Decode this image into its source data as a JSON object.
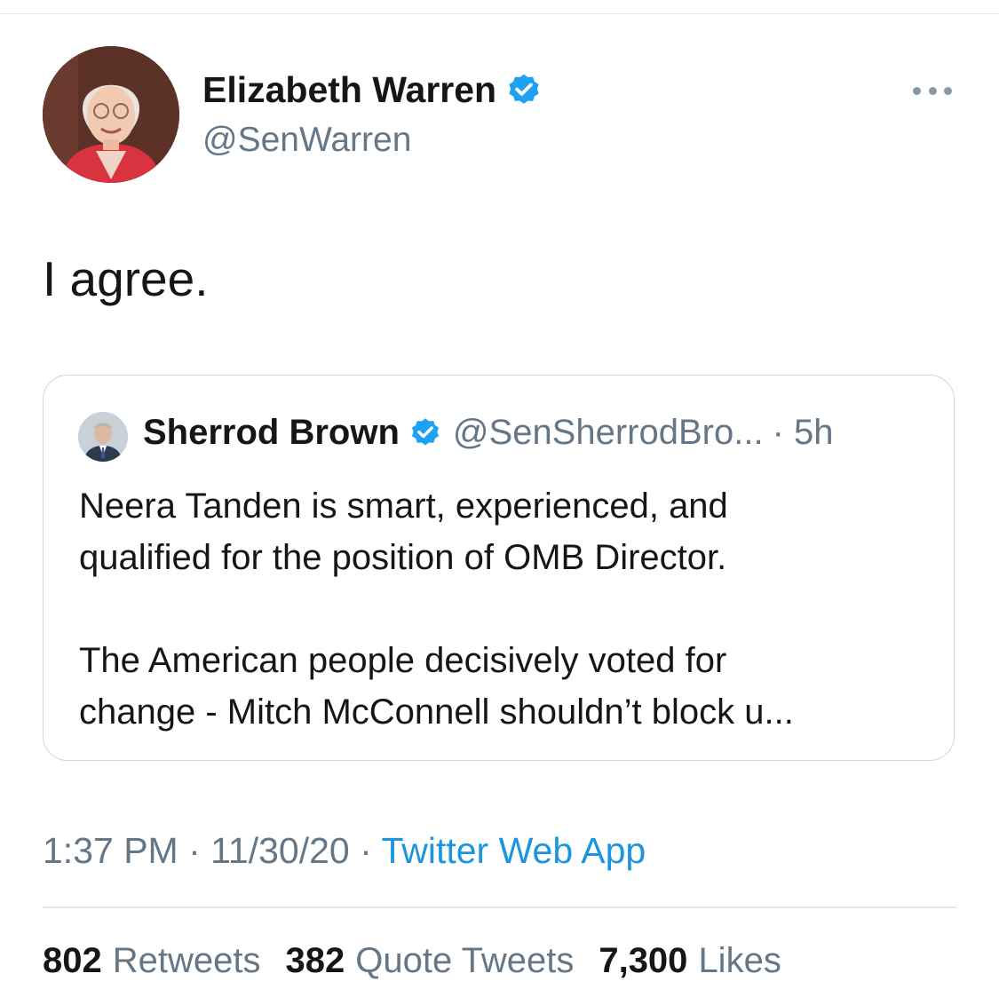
{
  "tweet": {
    "author_name": "Elizabeth Warren",
    "author_handle": "@SenWarren",
    "text": "I agree.",
    "timestamp_time": "1:37 PM",
    "separator": "·",
    "timestamp_date": "11/30/20",
    "source": "Twitter Web App"
  },
  "quote": {
    "author_name": "Sherrod Brown",
    "author_handle": "@SenSherrodBro...",
    "time": "· 5h",
    "lines": [
      "Neera Tanden is smart, experienced, and",
      "qualified for the position of OMB Director.",
      "The American people decisively voted for",
      "change - Mitch McConnell shouldn’t block u..."
    ]
  },
  "stats": [
    {
      "count": "802",
      "label": "Retweets"
    },
    {
      "count": "382",
      "label": "Quote Tweets"
    },
    {
      "count": "7,300",
      "label": "Likes"
    }
  ],
  "icons": {
    "verified": "verified-badge-icon",
    "more": "more-options-icon"
  },
  "colors": {
    "accent": "#1b95e0",
    "verified": "#1da1f2",
    "secondary_text": "#657786"
  }
}
